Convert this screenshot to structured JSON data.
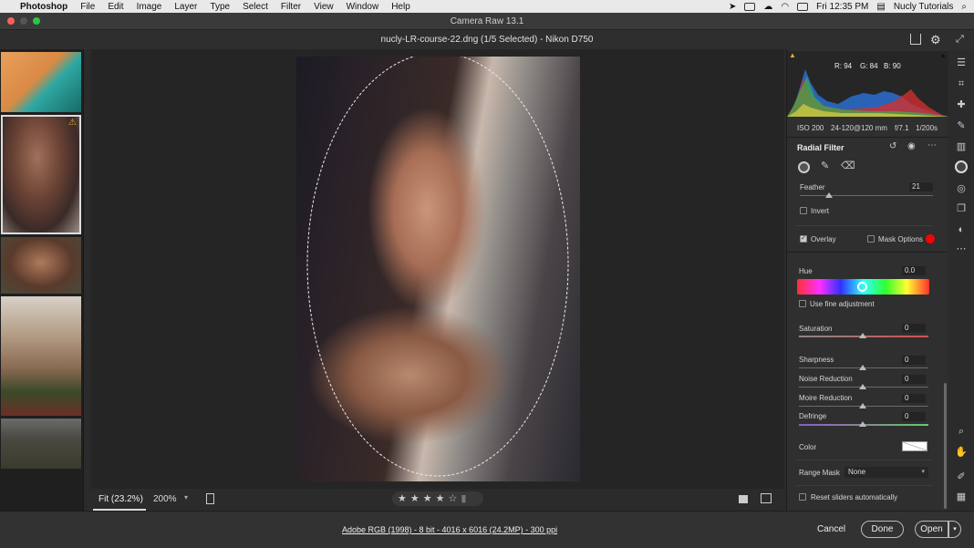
{
  "menubar": {
    "app": "Photoshop",
    "items": [
      "File",
      "Edit",
      "Image",
      "Layer",
      "Type",
      "Select",
      "Filter",
      "View",
      "Window",
      "Help"
    ],
    "clock": "Fri 12:35 PM",
    "user": "Nucly Tutorials"
  },
  "window_title": "Camera Raw 13.1",
  "file_title": "nucly-LR-course-22.dng (1/5 Selected)  -  Nikon D750",
  "histogram": {
    "r": "R: 94",
    "g": "G: 84",
    "b": "B: 90"
  },
  "exif": {
    "iso": "ISO 200",
    "lens": "24-120@120 mm",
    "aperture": "f/7.1",
    "shutter": "1/200s"
  },
  "panel": {
    "title": "Radial Filter",
    "feather_label": "Feather",
    "feather_value": "21",
    "invert_label": "Invert",
    "overlay_label": "Overlay",
    "mask_options_label": "Mask Options",
    "mask_color": "#ff0000",
    "hue_label": "Hue",
    "hue_value": "0.0",
    "fine_adjust_label": "Use fine adjustment",
    "saturation_label": "Saturation",
    "saturation_value": "0",
    "sharpness_label": "Sharpness",
    "sharpness_value": "0",
    "noise_label": "Noise Reduction",
    "noise_value": "0",
    "moire_label": "Moire Reduction",
    "moire_value": "0",
    "defringe_label": "Defringe",
    "defringe_value": "0",
    "color_label": "Color",
    "range_mask_label": "Range Mask",
    "range_mask_value": "None",
    "reset_label": "Reset sliders automatically"
  },
  "bottom": {
    "fit_label": "Fit (23.2%)",
    "zoom_label": "200%",
    "rating_stars": 4,
    "rating_max": 5
  },
  "status": {
    "info": "Adobe RGB (1998) - 8 bit - 4016 x 6016 (24.2MP) - 300 ppi",
    "cancel": "Cancel",
    "done": "Done",
    "open": "Open"
  },
  "icons": [
    "apple-icon",
    "search-icon",
    "download-icon",
    "gear-icon",
    "expand-icon",
    "edit-sliders-icon",
    "crop-icon",
    "healing-icon",
    "brush-icon",
    "gradient-icon",
    "radial-filter-icon",
    "red-eye-icon",
    "snapshots-icon",
    "presets-icon",
    "more-icon",
    "zoom-icon",
    "hand-icon",
    "sampler-icon",
    "grid-icon",
    "warning-icon"
  ]
}
